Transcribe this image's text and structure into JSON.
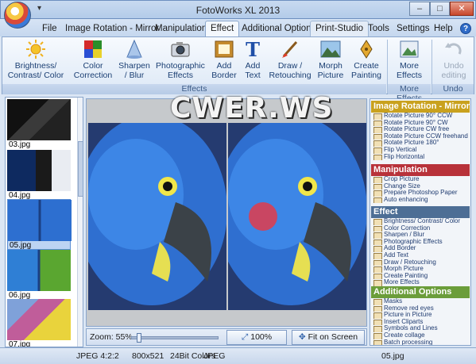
{
  "window": {
    "title": "FotoWorks XL 2013",
    "qa_arrow": "▾",
    "min": "–",
    "max": "□",
    "close": "✕"
  },
  "menu": {
    "tabs": [
      "File",
      "Image Rotation - Mirror",
      "Manipulation",
      "Effect",
      "Additional Options",
      "Print-Studio",
      "Tools",
      "Settings",
      "Help"
    ],
    "active": "Effect",
    "help_icon": "?"
  },
  "ribbon": {
    "buttons": [
      {
        "label1": "Brightness/",
        "label2": "Contrast/ Color",
        "icon": "sun-icon"
      },
      {
        "label1": "Color",
        "label2": "Correction",
        "icon": "color-palette-icon"
      },
      {
        "label1": "Sharpen",
        "label2": "/ Blur",
        "icon": "cone-icon"
      },
      {
        "label1": "Photographic",
        "label2": "Effects",
        "icon": "camera-icon"
      },
      {
        "label1": "Add",
        "label2": "Border",
        "icon": "frame-icon"
      },
      {
        "label1": "Add",
        "label2": "Text",
        "icon": "text-t-icon"
      },
      {
        "label1": "Draw /",
        "label2": "Retouching",
        "icon": "brush-icon"
      },
      {
        "label1": "Morph",
        "label2": "Picture",
        "icon": "mountain-picture-icon"
      },
      {
        "label1": "Create",
        "label2": "Painting",
        "icon": "pen-nib-icon"
      },
      {
        "label1": "More",
        "label2": "Effects",
        "icon": "more-effects-icon"
      },
      {
        "label1": "Undo",
        "label2": "editing",
        "icon": "undo-icon"
      }
    ],
    "groups": [
      "Effects",
      "More Effects",
      "Undo"
    ]
  },
  "thumbnails": [
    {
      "name": "03.jpg"
    },
    {
      "name": "04.jpg"
    },
    {
      "name": "05.jpg"
    },
    {
      "name": "06.jpg"
    },
    {
      "name": "07.jpg"
    }
  ],
  "viewer": {
    "watermark": "CWER.WS"
  },
  "zoombar": {
    "zoom_label": "Zoom: 55%",
    "zoom_level": 55,
    "btn_100": "100%",
    "btn_fit": "Fit on Screen"
  },
  "panel": {
    "sections": [
      {
        "title": "Image Rotation - Mirror",
        "color": "#c9a11e",
        "items": [
          "Rotate Picture 90° CCW",
          "Rotate Picture 90° CW",
          "Rotate Picture CW free",
          "Rotate Picture CCW freehand",
          "Rotate Picture 180°",
          "Flip Vertical",
          "Flip Horizontal"
        ]
      },
      {
        "title": "Manipulation",
        "color": "#b8323a",
        "items": [
          "Crop Picture",
          "Change Size",
          "Prepare Photoshop Paper",
          "Auto enhancing"
        ]
      },
      {
        "title": "Effect",
        "color": "#4d6e95",
        "items": [
          "Brightness/ Contrast/ Color",
          "Color Correction",
          "Sharpen / Blur",
          "Photographic Effects",
          "Add Border",
          "Add Text",
          "Draw / Retouching",
          "Morph Picture",
          "Create Painting",
          "More Effects"
        ]
      },
      {
        "title": "Additional Options",
        "color": "#6b9d3a",
        "items": [
          "Masks",
          "Remove red eyes",
          "Picture in Picture",
          "Insert Cliparts",
          "Symbols and Lines",
          "Create collage",
          "Batch processing"
        ]
      }
    ]
  },
  "status": {
    "format": "JPEG  4:2:2",
    "size": "800x521",
    "colors": "24Bit Colors",
    "type": "JPEG",
    "file": "05.jpg"
  }
}
